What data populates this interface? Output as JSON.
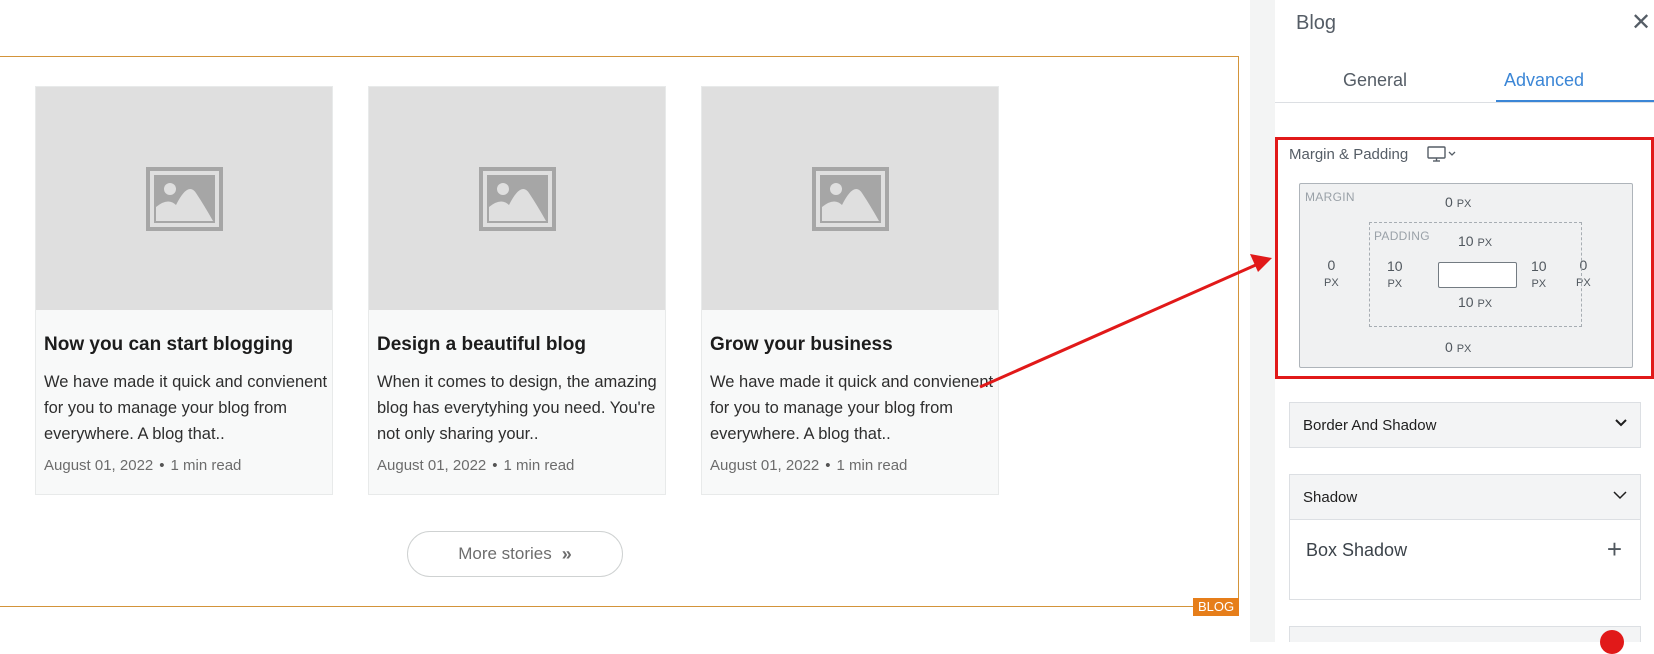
{
  "canvas": {
    "blog_tag": "BLOG",
    "cards": [
      {
        "title": "Now you can start blogging",
        "excerpt": "We have made it quick and convienent for you to manage your blog from everywhere. A blog that..",
        "date": "August 01, 2022",
        "read_time": "1 min read"
      },
      {
        "title": "Design a beautiful blog",
        "excerpt": "When it comes to design, the amazing blog has everytyhing you need. You're not only sharing your..",
        "date": "August 01, 2022",
        "read_time": "1 min read"
      },
      {
        "title": "Grow your business",
        "excerpt": "We have made it quick and convienent for you to manage your blog from everywhere. A blog that..",
        "date": "August 01, 2022",
        "read_time": "1 min read"
      }
    ],
    "more_button": {
      "label": "More stories",
      "icon": "double-chevron-right-icon"
    },
    "meta_separator": "•"
  },
  "panel": {
    "title": "Blog",
    "close_icon": "close-icon",
    "tabs": [
      {
        "label": "General",
        "active": false
      },
      {
        "label": "Advanced",
        "active": true
      }
    ],
    "margin_padding": {
      "label": "Margin & Padding",
      "device_icon": "desktop-icon",
      "margin_label": "MARGIN",
      "padding_label": "PADDING",
      "unit": "PX",
      "margin": {
        "top": "0",
        "right": "0",
        "bottom": "0",
        "left": "0"
      },
      "padding": {
        "top": "10",
        "right": "10",
        "bottom": "10",
        "left": "10"
      }
    },
    "sections": [
      {
        "label": "Border And Shadow",
        "expanded": false
      },
      {
        "label": "Shadow",
        "expanded": true
      }
    ],
    "box_shadow_label": "Box Shadow",
    "add_icon": "plus-icon"
  },
  "colors": {
    "accent": "#3b86d6",
    "frame": "#d3943a",
    "tag": "#e67e1a",
    "highlight": "#e11919"
  }
}
